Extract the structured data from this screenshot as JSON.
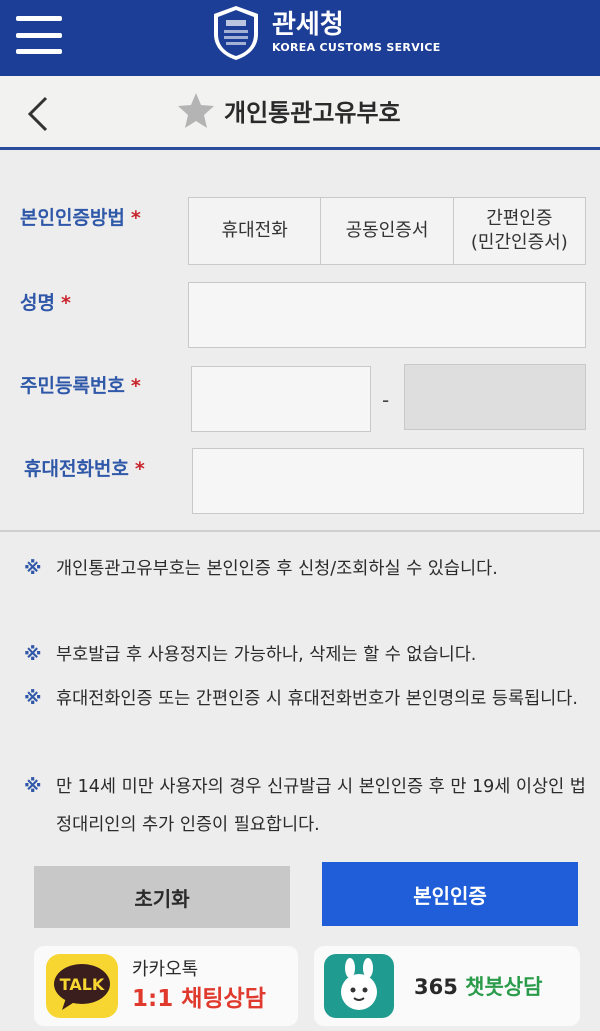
{
  "header": {
    "brand_kr": "관세청",
    "brand_en": "KOREA CUSTOMS SERVICE"
  },
  "titlebar": {
    "title": "개인통관고유부호"
  },
  "form": {
    "auth_method_label": "본인인증방법",
    "auth_methods": [
      "휴대전화",
      "공동인증서",
      "간편인증\n(민간인증서)"
    ],
    "name_label": "성명",
    "rrn_label": "주민등록번호",
    "rrn_separator": "-",
    "phone_label": "휴대전화번호",
    "required_mark": "*"
  },
  "notices": [
    {
      "mark": "※",
      "text": "개인통관고유부호는 본인인증 후 신청/조회하실 수 있습니다."
    },
    {
      "mark": "※",
      "text": "부호발급 후 사용정지는 가능하나, 삭제는 할 수 없습니다."
    },
    {
      "mark": "※",
      "text": "휴대전화인증 또는 간편인증 시 휴대전화번호가 본인명의로 등록됩니다."
    },
    {
      "mark": "※",
      "text": "만 14세 미만 사용자의 경우 신규발급 시 본인인증 후 만 19세 이상인 법정대리인의 추가 인증이 필요합니다."
    }
  ],
  "buttons": {
    "reset": "초기화",
    "auth": "본인인증"
  },
  "footer": {
    "kakao_top": "카카오톡",
    "kakao_bottom": "1:1 채팅상담",
    "kakao_icon_text": "TALK",
    "bot_number": "365",
    "bot_label": "챗봇상담"
  },
  "colors": {
    "header_bg": "#1d3e96",
    "label_blue": "#2f58a9",
    "required_red": "#c8242c",
    "primary_button": "#1f5ed8",
    "kakao_yellow": "#f7d631"
  }
}
